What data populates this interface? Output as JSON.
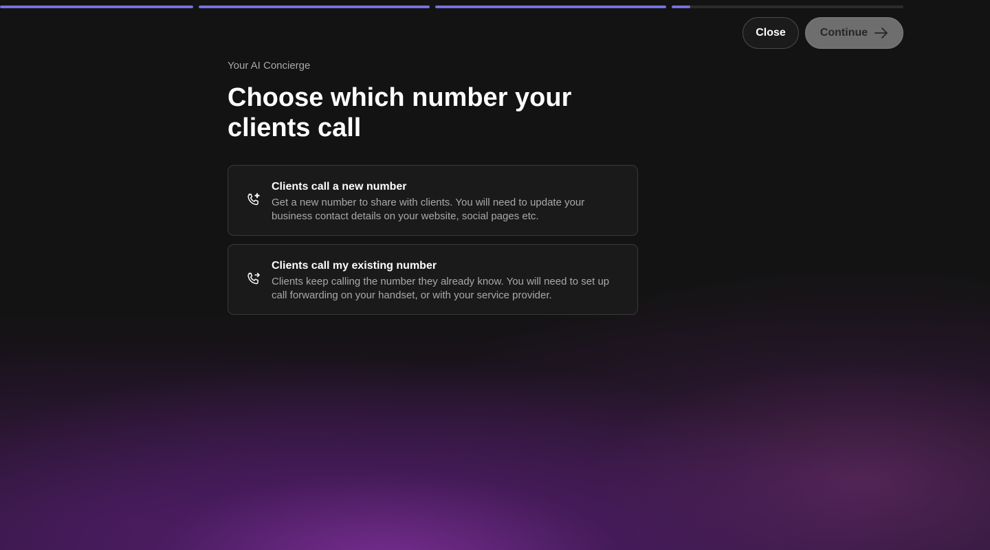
{
  "progress": {
    "segments": [
      {
        "fill": 1.0
      },
      {
        "fill": 1.0
      },
      {
        "fill": 1.0
      },
      {
        "fill": 0.08
      }
    ]
  },
  "header": {
    "close_label": "Close",
    "continue_label": "Continue"
  },
  "main": {
    "eyebrow": "Your AI Concierge",
    "title": "Choose which number your clients call"
  },
  "options": [
    {
      "icon": "phone-sparkle-icon",
      "title": "Clients call a new number",
      "description": "Get a new number to share with clients. You will need to update your business contact details on your website, social pages etc."
    },
    {
      "icon": "phone-forward-icon",
      "title": "Clients call my existing number",
      "description": "Clients keep calling the number they already know. You will need to set up call forwarding on your handset, or with your service provider."
    }
  ],
  "colors": {
    "accent": "#7472e0",
    "background": "#131313",
    "card": "#1a1a1a"
  }
}
